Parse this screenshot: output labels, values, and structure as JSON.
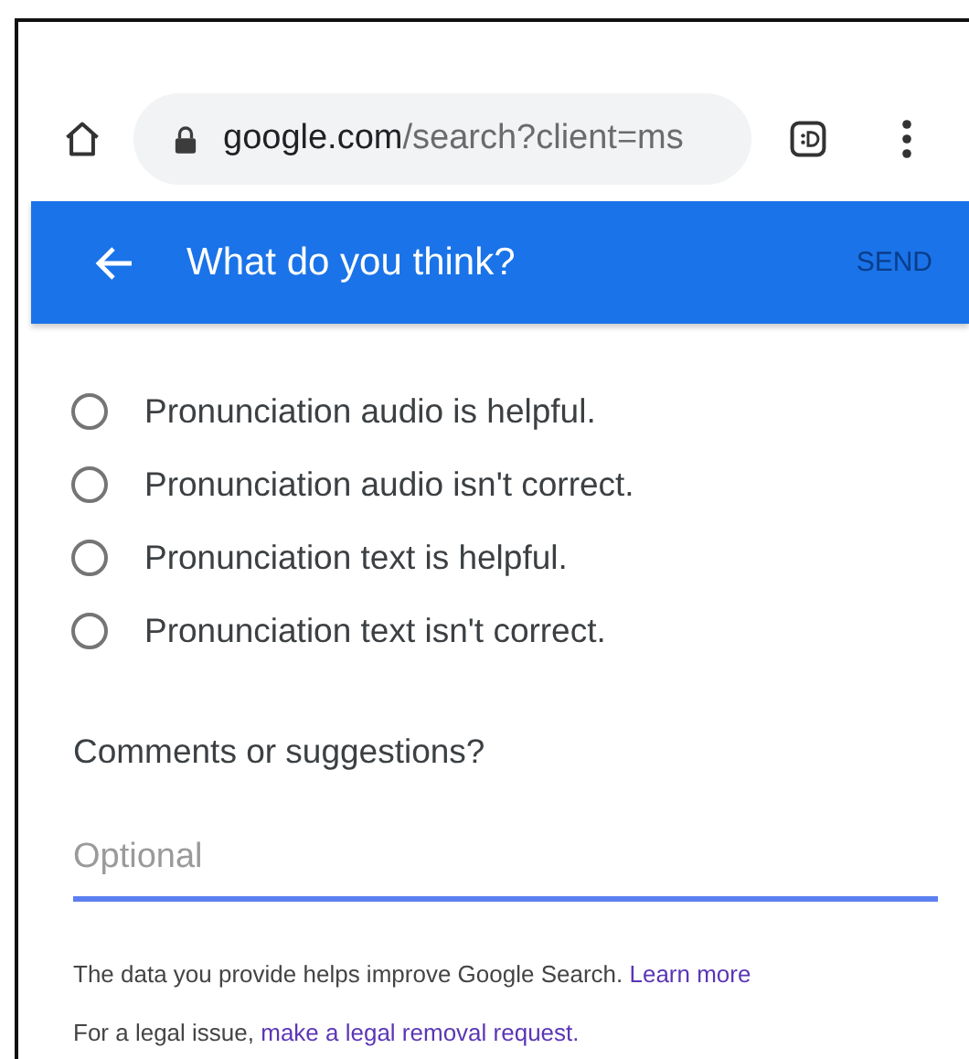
{
  "browser": {
    "url_host": "google.com",
    "url_path": "/search?client=ms"
  },
  "header": {
    "title": "What do you think?",
    "send": {
      "label": "SEND",
      "disabled": true
    }
  },
  "options": [
    {
      "label": "Pronunciation audio is helpful.",
      "selected": false
    },
    {
      "label": "Pronunciation audio isn't correct.",
      "selected": false
    },
    {
      "label": "Pronunciation text is helpful.",
      "selected": false
    },
    {
      "label": "Pronunciation text isn't correct.",
      "selected": false
    }
  ],
  "comments": {
    "label": "Comments or suggestions?",
    "placeholder": "Optional"
  },
  "notes": [
    {
      "text": "The data you provide helps improve Google Search.",
      "link": "Learn more"
    },
    {
      "text": "For a legal issue,",
      "link": "make a legal removal request."
    }
  ]
}
